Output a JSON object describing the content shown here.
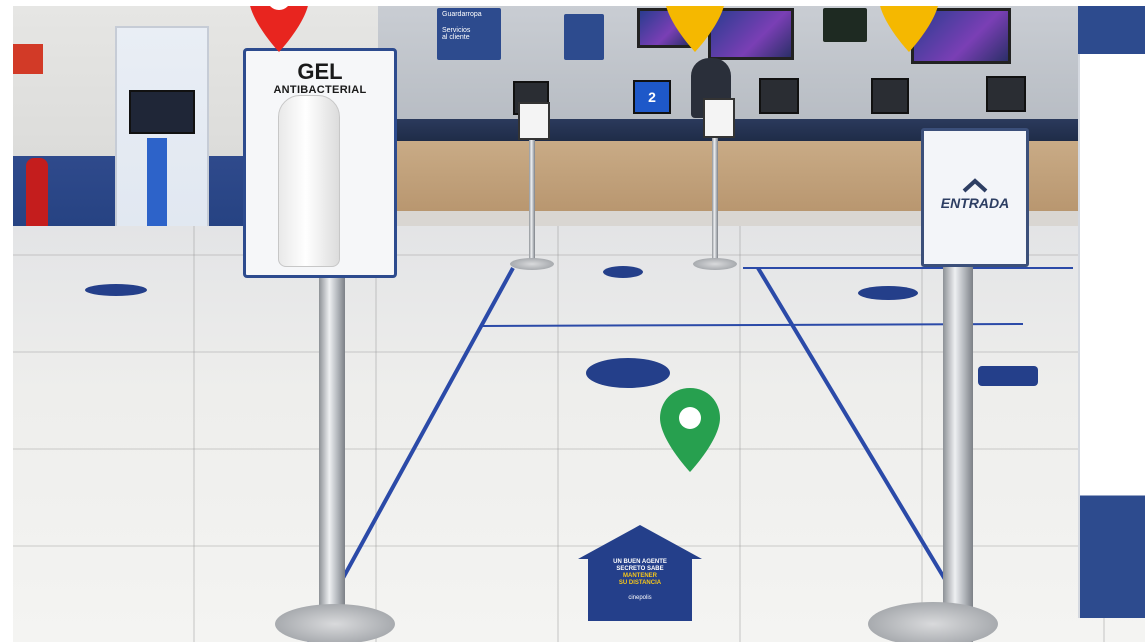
{
  "scene": {
    "gel_sign": {
      "line1": "GEL",
      "line2": "ANTIBACTERIAL"
    },
    "entrada_sign": {
      "label": "ENTRADA"
    },
    "back_signs": {
      "guardarropa": "Guardarropa",
      "servicio_line1": "Servicios",
      "servicio_line2": "al cliente",
      "counter_number": "2"
    },
    "floor_sticker": {
      "line1": "UN BUEN AGENTE",
      "line2": "SECRETO SABE",
      "line3": "MANTENER",
      "line4": "SU DISTANCIA",
      "brand": "cinepolis"
    },
    "pins": [
      {
        "color": "#e8251f",
        "name": "red"
      },
      {
        "color": "#f5b800",
        "name": "yellow"
      },
      {
        "color": "#f5b800",
        "name": "yellow"
      },
      {
        "color": "#27a04f",
        "name": "green"
      }
    ],
    "colors": {
      "brand_blue": "#2d4b8e",
      "counter_wood": "#c9ab86",
      "floor": "#eeeeec"
    }
  }
}
